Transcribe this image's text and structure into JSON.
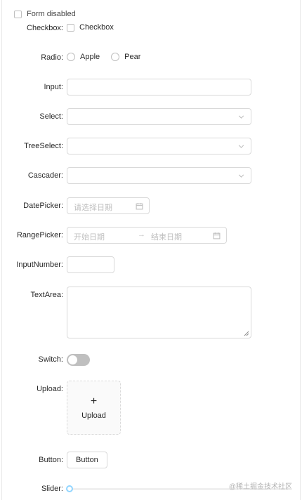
{
  "form_disabled": {
    "label": "Form disabled"
  },
  "fields": {
    "checkbox": {
      "label": "Checkbox:",
      "option": "Checkbox"
    },
    "radio": {
      "label": "Radio:",
      "options": [
        "Apple",
        "Pear"
      ]
    },
    "input": {
      "label": "Input:",
      "value": ""
    },
    "select": {
      "label": "Select:",
      "value": ""
    },
    "treeselect": {
      "label": "TreeSelect:",
      "value": ""
    },
    "cascader": {
      "label": "Cascader:",
      "value": ""
    },
    "datepicker": {
      "label": "DatePicker:",
      "placeholder": "请选择日期"
    },
    "rangepicker": {
      "label": "RangePicker:",
      "start_placeholder": "开始日期",
      "separator": "→",
      "end_placeholder": "结束日期"
    },
    "inputnumber": {
      "label": "InputNumber:",
      "value": ""
    },
    "textarea": {
      "label": "TextArea:",
      "value": ""
    },
    "switch": {
      "label": "Switch:"
    },
    "upload": {
      "label": "Upload:",
      "plus": "+",
      "text": "Upload"
    },
    "button": {
      "label": "Button:",
      "text": "Button"
    },
    "slider": {
      "label": "Slider:",
      "value": 0
    }
  },
  "watermark": "@稀土掘金技术社区"
}
